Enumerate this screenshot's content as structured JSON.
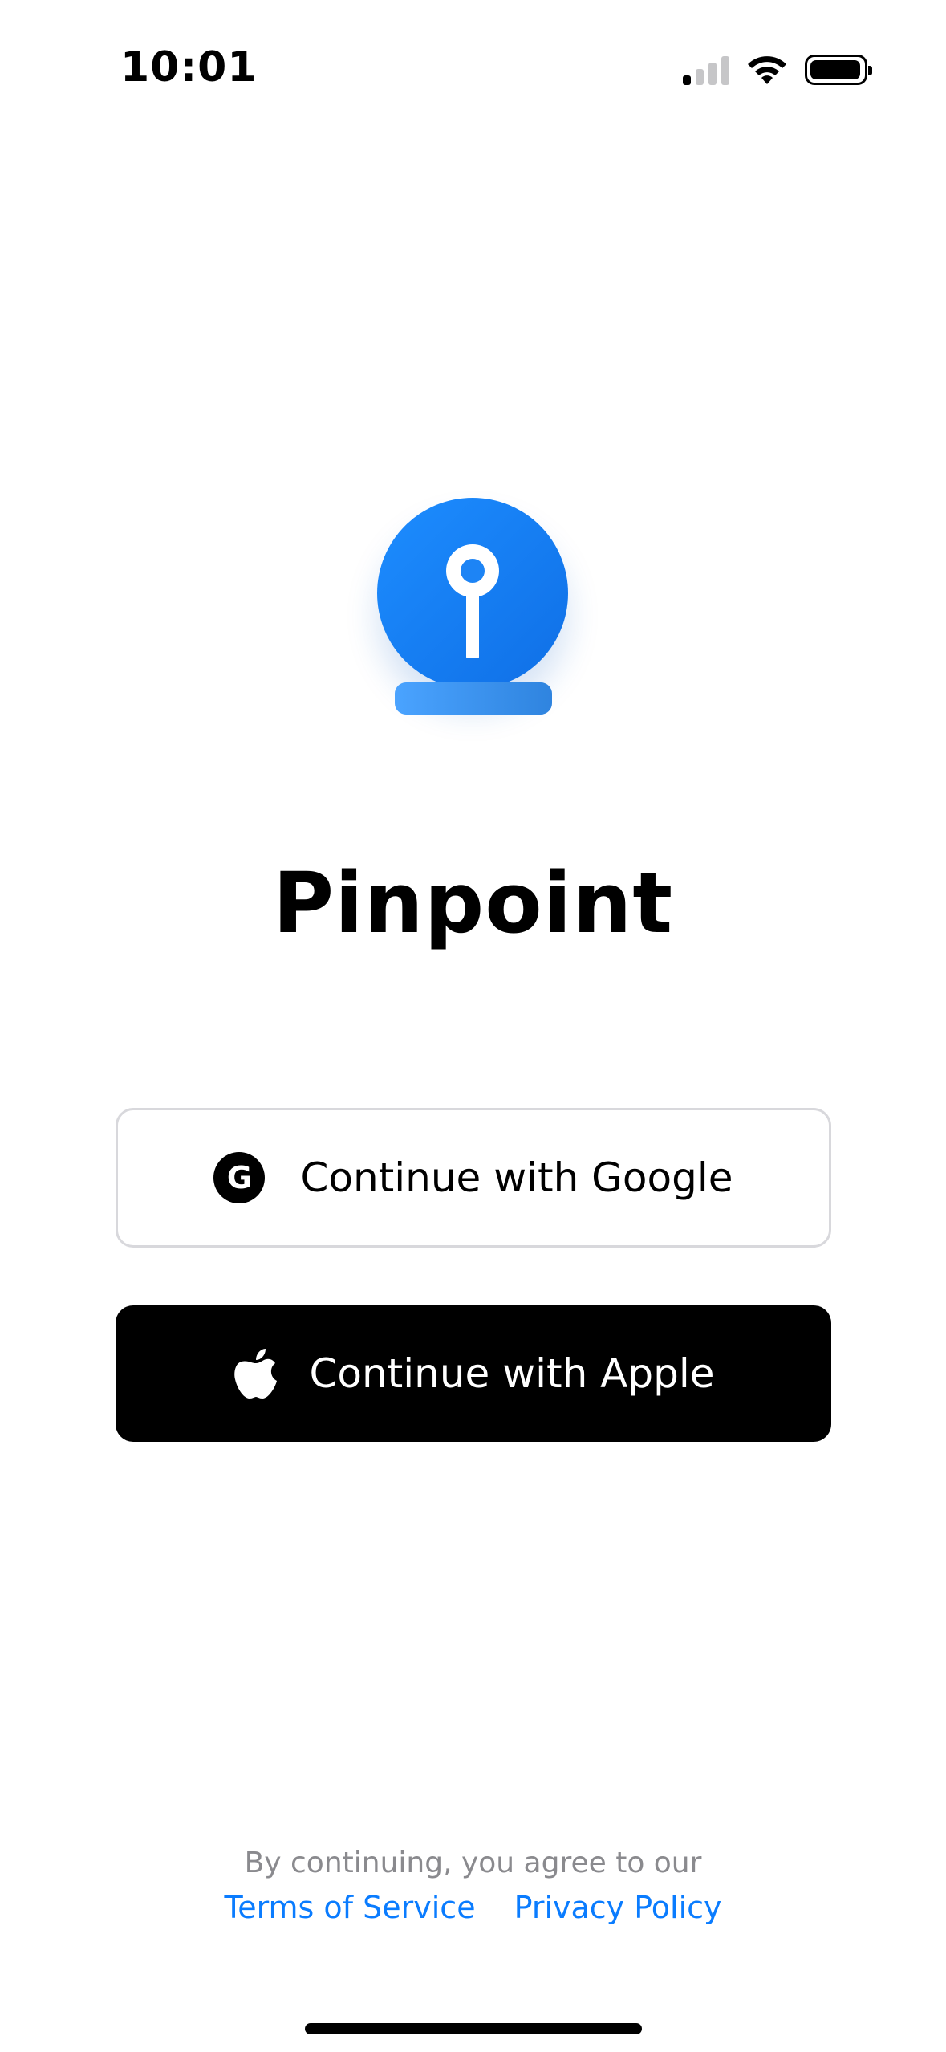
{
  "status_bar": {
    "time": "10:01",
    "icons": [
      "cellular-signal-icon",
      "wifi-icon",
      "battery-icon"
    ]
  },
  "app": {
    "logo_icon": "pin-logo-icon",
    "title": "Pinpoint"
  },
  "buttons": {
    "google": {
      "icon_letter": "G",
      "label": "Continue with Google"
    },
    "apple": {
      "label": "Continue with Apple"
    }
  },
  "footer": {
    "text": "By continuing, you agree to our",
    "terms": "Terms of Service",
    "privacy": "Privacy Policy"
  },
  "colors": {
    "accent_blue": "#1d8dff",
    "link_blue": "#0a7cff",
    "button_dark": "#000000",
    "border_gray": "#d8d8dc",
    "footer_gray": "#8a8a8e"
  }
}
